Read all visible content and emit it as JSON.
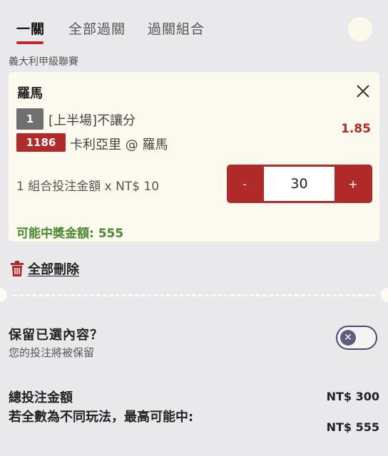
{
  "tabs": [
    {
      "label": "一關",
      "active": true
    },
    {
      "label": "全部過關",
      "active": false
    },
    {
      "label": "過關組合",
      "active": false
    }
  ],
  "league": "義大利甲級聯賽",
  "bet": {
    "team": "羅馬",
    "selection_number": "1",
    "market": "[上半場]不讓分",
    "odds": "1.85",
    "match_code": "1186",
    "match": "卡利亞里 @ 羅馬",
    "stake_label": "1 組合投注金額 x NT$ 10",
    "stepper": {
      "minus": "-",
      "value": "30",
      "plus": "+"
    },
    "potential_win": "可能中獎金額: 555"
  },
  "delete_all": "全部刪除",
  "keep": {
    "title": "保留已選內容？",
    "subtitle": "您的投注將被保留",
    "toggle_icon": "x-icon"
  },
  "summary": {
    "total_label": "總投注金額",
    "total_value": "NT$ 300",
    "max_label": "若全數為不同玩法，最高可能中:",
    "max_value": "NT$ 555"
  },
  "colors": {
    "accent": "#b02a2a",
    "win_green": "#4b8a2e",
    "card_bg": "#fcfaee",
    "page_bg": "#e9e9eb"
  }
}
